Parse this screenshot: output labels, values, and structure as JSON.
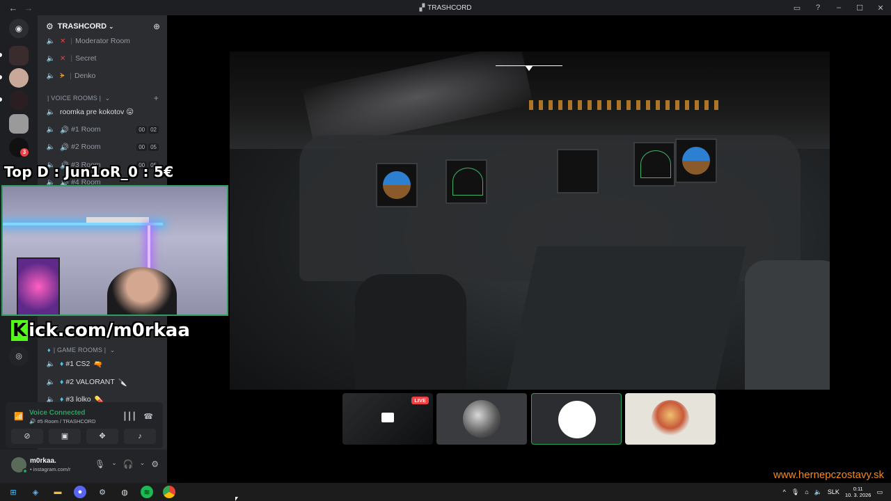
{
  "titlebar": {
    "title": "TRASHCORD",
    "back": "←",
    "forward": "→",
    "controls": [
      "▭",
      "?",
      "–",
      "☐",
      "✕"
    ]
  },
  "rail": {
    "servers": 8,
    "notification_badge": "3"
  },
  "server": {
    "name": "TRASHCORD"
  },
  "channels_top": [
    {
      "name": "Moderator Room",
      "marker": "✕",
      "marker_color": "#f23f43"
    },
    {
      "name": "Secret",
      "marker": "✕",
      "marker_color": "#f23f43"
    },
    {
      "name": "Denko",
      "marker": "ᗘ",
      "marker_color": "#f0a232"
    }
  ],
  "voice_category": "VOICE ROOMS",
  "voice_channels": [
    {
      "name": "roomka pre kokotov 😛",
      "c1": "",
      "c2": ""
    },
    {
      "name": "#1 Room",
      "c1": "00",
      "c2": "02"
    },
    {
      "name": "#2 Room",
      "c1": "00",
      "c2": "05"
    },
    {
      "name": "#3 Room",
      "c1": "00",
      "c2": "05"
    },
    {
      "name": "#4 Room",
      "c1": "",
      "c2": ""
    }
  ],
  "game_category": "GAME ROOMS",
  "game_channels": [
    {
      "name": "#1 CS2",
      "emoji": "🔫"
    },
    {
      "name": "#2 VALORANT",
      "emoji": "🔪"
    },
    {
      "name": "#3 lolko",
      "emoji": "💊"
    }
  ],
  "voice_panel": {
    "status": "Voice Connected",
    "room": "#5 Room / TRASHCORD"
  },
  "user_panel": {
    "name": "m0rkaa.",
    "status": "• instagram.com/r"
  },
  "overlays": {
    "top_donor": "Top D : Jun1oR_0 : 5€",
    "kick_k": "K",
    "kick_rest": "ick.com/m0rkaa",
    "watermark": "www.hernepczostavy.sk"
  },
  "thumbnails": {
    "live_label": "LIVE"
  },
  "taskbar": {
    "lang": "SLK",
    "time": "0:11",
    "date": "10. 3. 2026"
  },
  "colors": {
    "accent_green": "#23a55a",
    "live_red": "#f23f43",
    "kick_green": "#53fc18",
    "watermark_orange": "#f28a1a"
  }
}
